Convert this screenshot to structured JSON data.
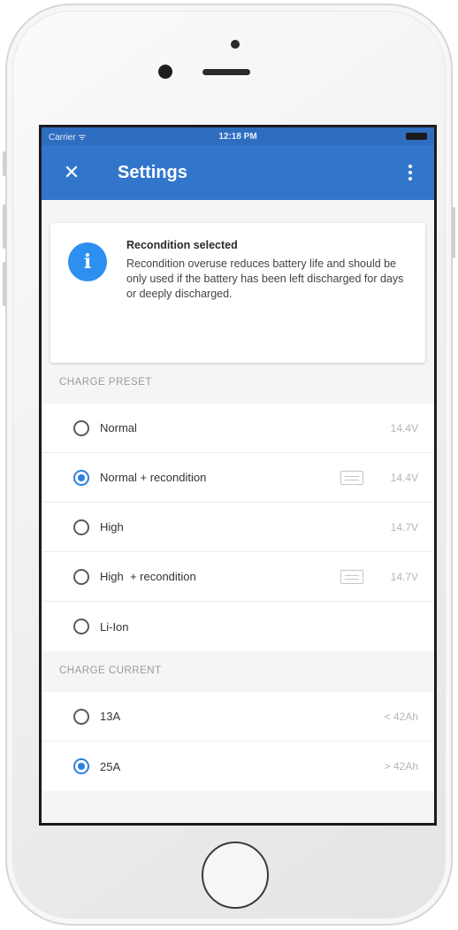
{
  "status_bar": {
    "carrier": "Carrier ᯤ",
    "time": "12:18 PM"
  },
  "app_bar": {
    "close_icon": "close-icon",
    "title": "Settings",
    "menu_icon": "more-vertical-icon"
  },
  "info_card": {
    "icon": "info-icon",
    "icon_glyph": "i",
    "title": "Recondition selected",
    "body": "Recondition overuse reduces battery life and should be only used if the battery has been left discharged for days or deeply discharged."
  },
  "charge_preset": {
    "header": "CHARGE PRESET",
    "items": [
      {
        "label": "Normal",
        "value": "14.4V",
        "selected": false,
        "recondition_icon": false
      },
      {
        "label": "Normal + recondition",
        "value": "14.4V",
        "selected": true,
        "recondition_icon": true
      },
      {
        "label": "High",
        "value": "14.7V",
        "selected": false,
        "recondition_icon": false
      },
      {
        "label": "High  + recondition",
        "value": "14.7V",
        "selected": false,
        "recondition_icon": true
      },
      {
        "label": "Li-Ion",
        "value": "",
        "selected": false,
        "recondition_icon": false
      }
    ]
  },
  "charge_current": {
    "header": "CHARGE CURRENT",
    "items": [
      {
        "label": "13A",
        "value": "< 42Ah",
        "selected": false
      },
      {
        "label": "25A",
        "value": "> 42Ah",
        "selected": true
      }
    ]
  },
  "colors": {
    "app_bar": "#3276cc",
    "accent": "#2d7fe0",
    "info_icon": "#2d8ff0"
  }
}
